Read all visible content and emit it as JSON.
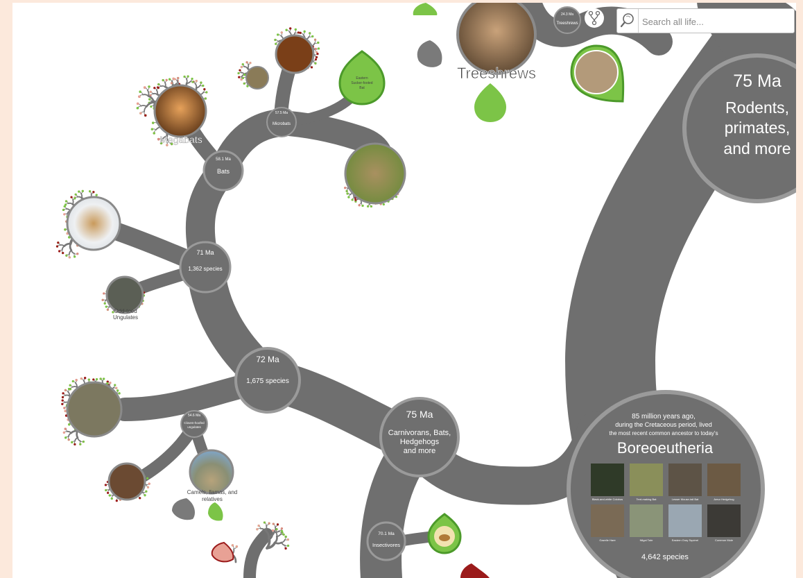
{
  "search": {
    "placeholder": "Search all life..."
  },
  "nodes": {
    "rodents_primates": {
      "age": "75 Ma",
      "name_lines": [
        "Rodents,",
        "primates,",
        "and more"
      ]
    },
    "carnivorans_bats": {
      "age": "75 Ma",
      "name_lines": [
        "Carnivorans, Bats,",
        "Hedgehogs",
        "and more"
      ]
    },
    "node_71": {
      "age": "71 Ma",
      "species": "1,362 species"
    },
    "node_72": {
      "age": "72 Ma",
      "species": "1,675 species"
    },
    "bats": {
      "age": "58.1 Ma",
      "name": "Bats"
    },
    "microbats": {
      "age": "57.5 Ma",
      "name": "Microbats"
    },
    "cloven": {
      "age": "54.6 Ma",
      "name_lines": [
        "Cloven-hoofed",
        "ungulates"
      ]
    },
    "insectivores": {
      "age": "70.1 Ma",
      "name": "Insectivores"
    },
    "treeshrews_small": {
      "age": "24.3 Ma",
      "name": "Treeshrews"
    }
  },
  "labels": {
    "treeshrews": "Treeshrews",
    "megabats": "Megabats",
    "odd_toed": [
      "Odd-toed",
      "Ungulates"
    ],
    "camels": [
      "Camels, llamas, and",
      "relatives"
    ],
    "eastern_bat": [
      "Eastern",
      "Sucker-footed",
      "Bat"
    ]
  },
  "boreoeutheria": {
    "intro_lines": [
      "85 million years ago,",
      "during the Cretaceous period, lived",
      "the most recent common ancestor to today's"
    ],
    "title": "Boreoeutheria",
    "species": "4,642 species",
    "thumbnails": [
      "Black-and-white Colobus",
      "Tent-making Bat",
      "Lesser Mouse-tail Bat",
      "Amur Hedgehog",
      "Gazelle Hare",
      "Nilgai Tahr",
      "Eastern Gray Squirrel",
      "Common Mole"
    ]
  },
  "colors": {
    "branch": "#6f6f6f",
    "leaf_green": "#7cc447",
    "leaf_red": "#9b1b1b",
    "leaf_pink": "#e8a195",
    "background": "#fce9dc"
  }
}
